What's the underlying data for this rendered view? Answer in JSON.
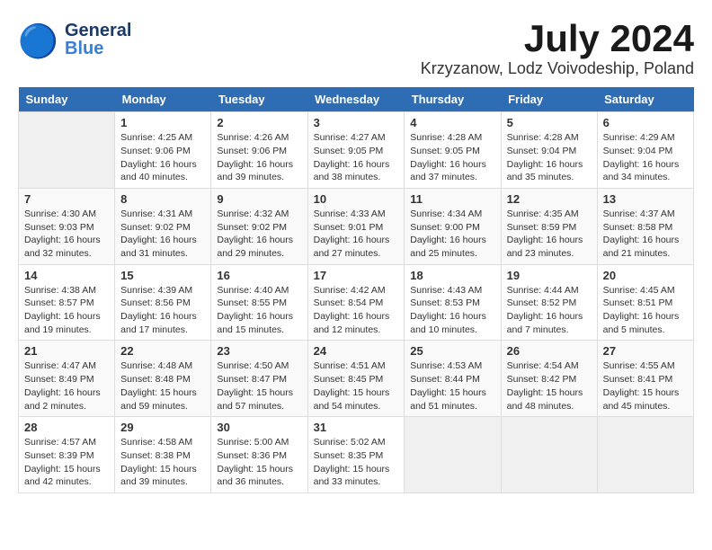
{
  "header": {
    "logo_general": "General",
    "logo_blue": "Blue",
    "month_title": "July 2024",
    "location": "Krzyzanow, Lodz Voivodeship, Poland"
  },
  "weekdays": [
    "Sunday",
    "Monday",
    "Tuesday",
    "Wednesday",
    "Thursday",
    "Friday",
    "Saturday"
  ],
  "weeks": [
    [
      {
        "num": "",
        "empty": true
      },
      {
        "num": "1",
        "sunrise": "Sunrise: 4:25 AM",
        "sunset": "Sunset: 9:06 PM",
        "daylight": "Daylight: 16 hours and 40 minutes."
      },
      {
        "num": "2",
        "sunrise": "Sunrise: 4:26 AM",
        "sunset": "Sunset: 9:06 PM",
        "daylight": "Daylight: 16 hours and 39 minutes."
      },
      {
        "num": "3",
        "sunrise": "Sunrise: 4:27 AM",
        "sunset": "Sunset: 9:05 PM",
        "daylight": "Daylight: 16 hours and 38 minutes."
      },
      {
        "num": "4",
        "sunrise": "Sunrise: 4:28 AM",
        "sunset": "Sunset: 9:05 PM",
        "daylight": "Daylight: 16 hours and 37 minutes."
      },
      {
        "num": "5",
        "sunrise": "Sunrise: 4:28 AM",
        "sunset": "Sunset: 9:04 PM",
        "daylight": "Daylight: 16 hours and 35 minutes."
      },
      {
        "num": "6",
        "sunrise": "Sunrise: 4:29 AM",
        "sunset": "Sunset: 9:04 PM",
        "daylight": "Daylight: 16 hours and 34 minutes."
      }
    ],
    [
      {
        "num": "7",
        "sunrise": "Sunrise: 4:30 AM",
        "sunset": "Sunset: 9:03 PM",
        "daylight": "Daylight: 16 hours and 32 minutes."
      },
      {
        "num": "8",
        "sunrise": "Sunrise: 4:31 AM",
        "sunset": "Sunset: 9:02 PM",
        "daylight": "Daylight: 16 hours and 31 minutes."
      },
      {
        "num": "9",
        "sunrise": "Sunrise: 4:32 AM",
        "sunset": "Sunset: 9:02 PM",
        "daylight": "Daylight: 16 hours and 29 minutes."
      },
      {
        "num": "10",
        "sunrise": "Sunrise: 4:33 AM",
        "sunset": "Sunset: 9:01 PM",
        "daylight": "Daylight: 16 hours and 27 minutes."
      },
      {
        "num": "11",
        "sunrise": "Sunrise: 4:34 AM",
        "sunset": "Sunset: 9:00 PM",
        "daylight": "Daylight: 16 hours and 25 minutes."
      },
      {
        "num": "12",
        "sunrise": "Sunrise: 4:35 AM",
        "sunset": "Sunset: 8:59 PM",
        "daylight": "Daylight: 16 hours and 23 minutes."
      },
      {
        "num": "13",
        "sunrise": "Sunrise: 4:37 AM",
        "sunset": "Sunset: 8:58 PM",
        "daylight": "Daylight: 16 hours and 21 minutes."
      }
    ],
    [
      {
        "num": "14",
        "sunrise": "Sunrise: 4:38 AM",
        "sunset": "Sunset: 8:57 PM",
        "daylight": "Daylight: 16 hours and 19 minutes."
      },
      {
        "num": "15",
        "sunrise": "Sunrise: 4:39 AM",
        "sunset": "Sunset: 8:56 PM",
        "daylight": "Daylight: 16 hours and 17 minutes."
      },
      {
        "num": "16",
        "sunrise": "Sunrise: 4:40 AM",
        "sunset": "Sunset: 8:55 PM",
        "daylight": "Daylight: 16 hours and 15 minutes."
      },
      {
        "num": "17",
        "sunrise": "Sunrise: 4:42 AM",
        "sunset": "Sunset: 8:54 PM",
        "daylight": "Daylight: 16 hours and 12 minutes."
      },
      {
        "num": "18",
        "sunrise": "Sunrise: 4:43 AM",
        "sunset": "Sunset: 8:53 PM",
        "daylight": "Daylight: 16 hours and 10 minutes."
      },
      {
        "num": "19",
        "sunrise": "Sunrise: 4:44 AM",
        "sunset": "Sunset: 8:52 PM",
        "daylight": "Daylight: 16 hours and 7 minutes."
      },
      {
        "num": "20",
        "sunrise": "Sunrise: 4:45 AM",
        "sunset": "Sunset: 8:51 PM",
        "daylight": "Daylight: 16 hours and 5 minutes."
      }
    ],
    [
      {
        "num": "21",
        "sunrise": "Sunrise: 4:47 AM",
        "sunset": "Sunset: 8:49 PM",
        "daylight": "Daylight: 16 hours and 2 minutes."
      },
      {
        "num": "22",
        "sunrise": "Sunrise: 4:48 AM",
        "sunset": "Sunset: 8:48 PM",
        "daylight": "Daylight: 15 hours and 59 minutes."
      },
      {
        "num": "23",
        "sunrise": "Sunrise: 4:50 AM",
        "sunset": "Sunset: 8:47 PM",
        "daylight": "Daylight: 15 hours and 57 minutes."
      },
      {
        "num": "24",
        "sunrise": "Sunrise: 4:51 AM",
        "sunset": "Sunset: 8:45 PM",
        "daylight": "Daylight: 15 hours and 54 minutes."
      },
      {
        "num": "25",
        "sunrise": "Sunrise: 4:53 AM",
        "sunset": "Sunset: 8:44 PM",
        "daylight": "Daylight: 15 hours and 51 minutes."
      },
      {
        "num": "26",
        "sunrise": "Sunrise: 4:54 AM",
        "sunset": "Sunset: 8:42 PM",
        "daylight": "Daylight: 15 hours and 48 minutes."
      },
      {
        "num": "27",
        "sunrise": "Sunrise: 4:55 AM",
        "sunset": "Sunset: 8:41 PM",
        "daylight": "Daylight: 15 hours and 45 minutes."
      }
    ],
    [
      {
        "num": "28",
        "sunrise": "Sunrise: 4:57 AM",
        "sunset": "Sunset: 8:39 PM",
        "daylight": "Daylight: 15 hours and 42 minutes."
      },
      {
        "num": "29",
        "sunrise": "Sunrise: 4:58 AM",
        "sunset": "Sunset: 8:38 PM",
        "daylight": "Daylight: 15 hours and 39 minutes."
      },
      {
        "num": "30",
        "sunrise": "Sunrise: 5:00 AM",
        "sunset": "Sunset: 8:36 PM",
        "daylight": "Daylight: 15 hours and 36 minutes."
      },
      {
        "num": "31",
        "sunrise": "Sunrise: 5:02 AM",
        "sunset": "Sunset: 8:35 PM",
        "daylight": "Daylight: 15 hours and 33 minutes."
      },
      {
        "num": "",
        "empty": true
      },
      {
        "num": "",
        "empty": true
      },
      {
        "num": "",
        "empty": true
      }
    ]
  ]
}
